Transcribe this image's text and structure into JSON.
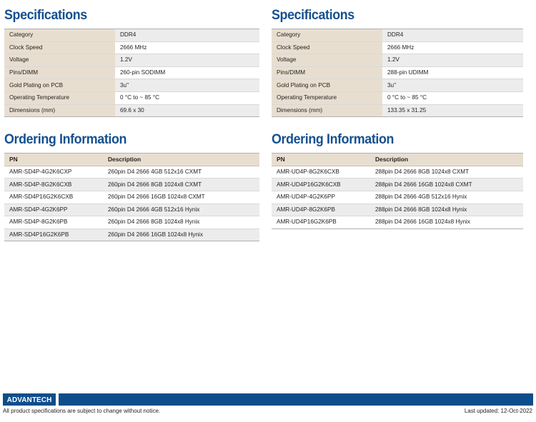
{
  "columns": [
    {
      "specs": {
        "title": "Specifications",
        "rows": [
          {
            "label": "Category",
            "value": "DDR4"
          },
          {
            "label": "Clock Speed",
            "value": "2666 MHz"
          },
          {
            "label": "Voltage",
            "value": "1.2V"
          },
          {
            "label": "Pins/DIMM",
            "value": "260-pin SODIMM"
          },
          {
            "label": "Gold Plating on PCB",
            "value": "3u\""
          },
          {
            "label": "Operating Temperature",
            "value": "0 °C to ~ 85 °C"
          },
          {
            "label": "Dimensions (mm)",
            "value": "69.6 x 30"
          }
        ]
      },
      "ordering": {
        "title": "Ordering Information",
        "headers": {
          "pn": "PN",
          "description": "Description"
        },
        "rows": [
          {
            "pn": "AMR-SD4P-4G2K6CXP",
            "description": "260pin D4 2666 4GB  512x16 CXMT"
          },
          {
            "pn": "AMR-SD4P-8G2K6CXB",
            "description": "260pin D4 2666 8GB 1024x8 CXMT"
          },
          {
            "pn": "AMR-SD4P16G2K6CXB",
            "description": "260pin D4 2666 16GB 1024x8 CXMT"
          },
          {
            "pn": "AMR-SD4P-4G2K6PP",
            "description": "260pin D4 2666 4GB 512x16 Hynix"
          },
          {
            "pn": "AMR-SD4P-8G2K6PB",
            "description": "260pin D4 2666 8GB 1024x8 Hynix"
          },
          {
            "pn": "AMR-SD4P16G2K6PB",
            "description": "260pin D4 2666 16GB 1024x8 Hynix"
          }
        ]
      }
    },
    {
      "specs": {
        "title": "Specifications",
        "rows": [
          {
            "label": "Category",
            "value": "DDR4"
          },
          {
            "label": "Clock Speed",
            "value": "2666 MHz"
          },
          {
            "label": "Voltage",
            "value": "1.2V"
          },
          {
            "label": "Pins/DIMM",
            "value": "288-pin UDIMM"
          },
          {
            "label": "Gold Plating on PCB",
            "value": "3u\""
          },
          {
            "label": "Operating Temperature",
            "value": "0 °C to ~ 85 °C"
          },
          {
            "label": "Dimensions (mm)",
            "value": "133.35 x 31.25"
          }
        ]
      },
      "ordering": {
        "title": "Ordering Information",
        "headers": {
          "pn": "PN",
          "description": "Description"
        },
        "rows": [
          {
            "pn": "AMR-UD4P-8G2K6CXB",
            "description": "288pin D4 2666 8GB 1024x8 CXMT"
          },
          {
            "pn": "AMR-UD4P16G2K6CXB",
            "description": "288pin D4 2666 16GB 1024x8 CXMT"
          },
          {
            "pn": "AMR-UD4P-4G2K6PP",
            "description": "288pin D4 2666 4GB 512x16 Hynix"
          },
          {
            "pn": "AMR-UD4P-8G2K6PB",
            "description": "288pin D4 2666 8GB 1024x8 Hynix"
          },
          {
            "pn": "AMR-UD4P16G2K6PB",
            "description": "288pin D4 2666 16GB 1024x8 Hynix"
          }
        ]
      }
    }
  ],
  "footer": {
    "logo": "ADVANTECH",
    "disclaimer": "All product specifications are subject to change without notice.",
    "last_updated": "Last updated: 12-Oct-2022",
    "bar_color": "#0d4d8c"
  },
  "theme": {
    "title_color": "#15508f",
    "label_cell_bg": "#e8ded0",
    "alt_row_bg": "#ececec",
    "text_color": "#231f20"
  }
}
